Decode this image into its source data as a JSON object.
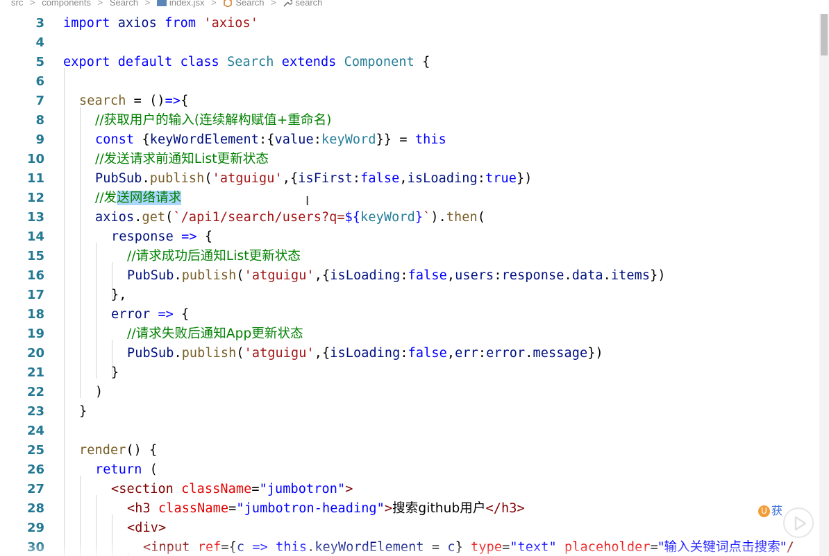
{
  "breadcrumb": {
    "items": [
      "src",
      "components",
      "Search",
      "index.jsx",
      "Search",
      "search"
    ],
    "separator": ">"
  },
  "editor": {
    "line_numbers": [
      "3",
      "4",
      "5",
      "6",
      "7",
      "8",
      "9",
      "10",
      "11",
      "12",
      "13",
      "14",
      "15",
      "16",
      "17",
      "18",
      "19",
      "20",
      "21",
      "22",
      "23",
      "24",
      "25",
      "26",
      "27",
      "28",
      "29",
      "30"
    ]
  },
  "code": {
    "l3_import": "import",
    "l3_axios": "axios",
    "l3_from": "from",
    "l3_str": "'axios'",
    "l5_export": "export",
    "l5_default": "default",
    "l5_class": "class",
    "l5_name": "Search",
    "l5_extends": "extends",
    "l5_component": "Component",
    "l5_brace": "{",
    "l7_search": "search",
    "l7_rest": " = ()",
    "l7_arrow": "=>",
    "l7_brace": "{",
    "l8_comment": "//获取用户的输入(连续解构赋值+重命名)",
    "l9_const": "const",
    "l9_a": "{",
    "l9_kwe": "keyWordElement",
    "l9_b": ":{",
    "l9_value": "value",
    "l9_c": ":",
    "l9_kw": "keyWord",
    "l9_d": "}} = ",
    "l9_this": "this",
    "l10_comment": "//发送请求前通知List更新状态",
    "l11_pubsub": "PubSub",
    "l11_dot": ".",
    "l11_publish": "publish",
    "l11_paren": "(",
    "l11_str": "'atguigu'",
    "l11_a": ",{",
    "l11_isfirst": "isFirst",
    "l11_b": ":",
    "l11_false": "false",
    "l11_c": ",",
    "l11_isloading": "isLoading",
    "l11_d": ":",
    "l11_true": "true",
    "l11_e": "})",
    "l12_comment_a": "//发",
    "l12_comment_b": "送网络请求",
    "l13_axios": "axios",
    "l13_dot": ".",
    "l13_get": "get",
    "l13_paren": "(",
    "l13_tmpl": "`/api1/search/users?q=",
    "l13_dollar": "${",
    "l13_kw": "keyWord",
    "l13_close": "}",
    "l13_tick": "`",
    "l13_b": ").",
    "l13_then": "then",
    "l13_c": "(",
    "l14_response": "response",
    "l14_arrow": " => ",
    "l14_brace": "{",
    "l15_comment": "//请求成功后通知List更新状态",
    "l16_pubsub": "PubSub",
    "l16_dot": ".",
    "l16_publish": "publish",
    "l16_paren": "(",
    "l16_str": "'atguigu'",
    "l16_a": ",{",
    "l16_isloading": "isLoading",
    "l16_b": ":",
    "l16_false": "false",
    "l16_c": ",",
    "l16_users": "users",
    "l16_d": ":",
    "l16_response": "response",
    "l16_e": ".",
    "l16_data": "data",
    "l16_f": ".",
    "l16_items": "items",
    "l16_g": "})",
    "l17": "},",
    "l18_error": "error",
    "l18_arrow": " => ",
    "l18_brace": "{",
    "l19_comment": "//请求失败后通知App更新状态",
    "l20_pubsub": "PubSub",
    "l20_dot": ".",
    "l20_publish": "publish",
    "l20_paren": "(",
    "l20_str": "'atguigu'",
    "l20_a": ",{",
    "l20_isloading": "isLoading",
    "l20_b": ":",
    "l20_false": "false",
    "l20_c": ",",
    "l20_err": "err",
    "l20_d": ":",
    "l20_error": "error",
    "l20_e": ".",
    "l20_message": "message",
    "l20_f": "})",
    "l21": "}",
    "l22": ")",
    "l23": "}",
    "l25_render": "render",
    "l25_rest": "() {",
    "l26_return": "return",
    "l26_rest": " (",
    "l27_open": "<",
    "l27_tag": "section",
    "l27_attr": "className",
    "l27_eq": "=",
    "l27_val": "\"jumbotron\"",
    "l27_close": ">",
    "l28_open": "<",
    "l28_tag": "h3",
    "l28_attr": "className",
    "l28_eq": "=",
    "l28_val": "\"jumbotron-heading\"",
    "l28_close": ">",
    "l28_text": "搜索github用户",
    "l28_end_open": "</",
    "l28_end_tag": "h3",
    "l28_end_close": ">",
    "l29_open": "<",
    "l29_tag": "div",
    "l29_close": ">",
    "l30_open": "<",
    "l30_tag": "input",
    "l30_ref": "ref",
    "l30_a": "={",
    "l30_c": "c",
    "l30_arrow": " => ",
    "l30_this": "this",
    "l30_b": ".",
    "l30_kwe": "keyWordElement",
    "l30_c2": " = ",
    "l30_c3": "c",
    "l30_d": "} ",
    "l30_type": "type",
    "l30_e": "=",
    "l30_typeval": "\"text\"",
    "l30_f": " ",
    "l30_ph": "placeholder",
    "l30_g": "=",
    "l30_phval": "\"输入关键词点击搜索\"",
    "l30_slash": "/"
  },
  "overlay": {
    "logo_text": "获",
    "play_icon": "play-icon"
  },
  "colors": {
    "keyword": "#0000ff",
    "function": "#795e26",
    "class": "#267f99",
    "string": "#a31515",
    "variable": "#001080",
    "comment": "#008000",
    "line_number": "#237893",
    "selection": "#add6ff"
  }
}
